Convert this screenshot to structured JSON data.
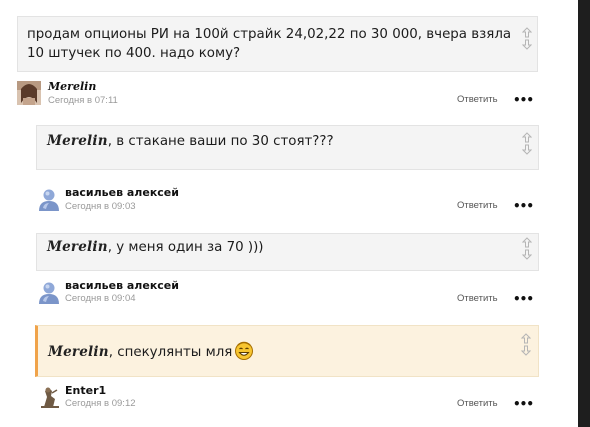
{
  "comments": [
    {
      "text": "продам опционы РИ на 100й страйк 24,02,22  по 30 000, вчера взяла 10 штучек по 400. надо кому?",
      "author": "Merelin",
      "time": "Сегодня в 07:11",
      "reply": "Ответить",
      "avatar_icon": "user-photo-icon"
    },
    {
      "mention": "Merelin",
      "text": ", в стакане ваши по 30 стоят???",
      "author": "васильев алексей",
      "time": "Сегодня в 09:03",
      "reply": "Ответить",
      "avatar_icon": "default-user-icon"
    },
    {
      "mention": "Merelin",
      "text": ", у меня один за 70 )))",
      "author": "васильев алексей",
      "time": "Сегодня в 09:04",
      "reply": "Ответить",
      "avatar_icon": "default-user-icon"
    },
    {
      "mention": "Merelin",
      "text": ", спекулянты мля",
      "emoji": "smiley-icon",
      "author": "Enter1",
      "time": "Сегодня в 09:12",
      "reply": "Ответить",
      "avatar_icon": "user-photo-icon",
      "highlighted": true
    }
  ],
  "colors": {
    "bubble_bg": "#f4f4f4",
    "highlight_bg": "#fcf2df",
    "highlight_accent": "#f0a34a",
    "meta_gray": "#9a9a9a"
  }
}
